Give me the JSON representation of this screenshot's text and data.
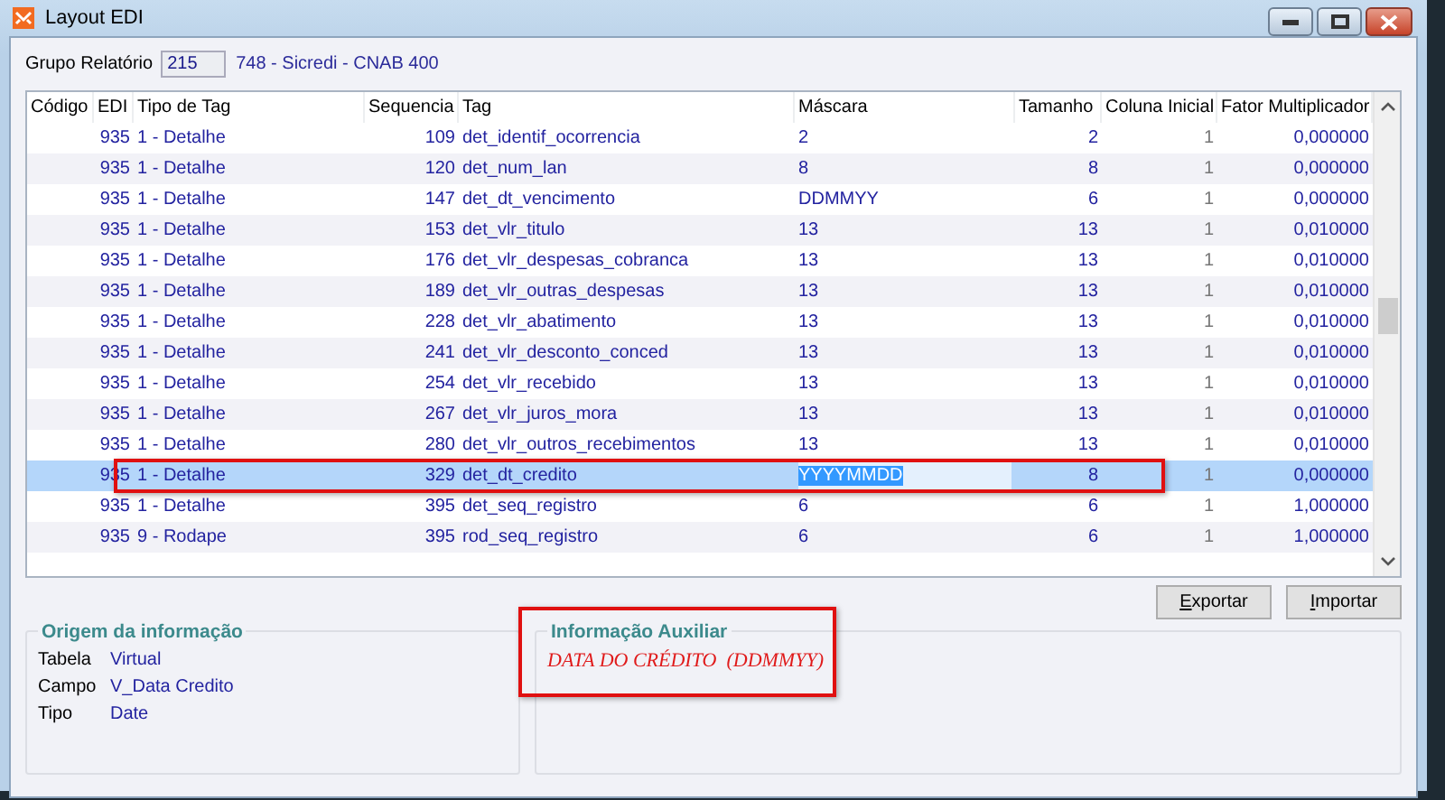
{
  "window": {
    "title": "Layout EDI"
  },
  "group": {
    "label": "Grupo Relatório",
    "value": "215",
    "description": "748 - Sicredi - CNAB 400"
  },
  "table": {
    "columns": [
      "Código",
      "EDI",
      "Tipo de Tag",
      "Sequencia",
      "Tag",
      "Máscara",
      "Tamanho",
      "Coluna Inicial",
      "Fator Multiplicador"
    ],
    "rows": [
      {
        "edi": "935",
        "tipo": "1 - Detalhe",
        "seq": "109",
        "tag": "det_identif_ocorrencia",
        "mascara": "2",
        "tamanho": "2",
        "coluna": "1",
        "fator": "0,000000",
        "selected": false,
        "editing": false
      },
      {
        "edi": "935",
        "tipo": "1 - Detalhe",
        "seq": "120",
        "tag": "det_num_lan",
        "mascara": "8",
        "tamanho": "8",
        "coluna": "1",
        "fator": "0,000000",
        "selected": false,
        "editing": false
      },
      {
        "edi": "935",
        "tipo": "1 - Detalhe",
        "seq": "147",
        "tag": "det_dt_vencimento",
        "mascara": "DDMMYY",
        "tamanho": "6",
        "coluna": "1",
        "fator": "0,000000",
        "selected": false,
        "editing": false
      },
      {
        "edi": "935",
        "tipo": "1 - Detalhe",
        "seq": "153",
        "tag": "det_vlr_titulo",
        "mascara": "13",
        "tamanho": "13",
        "coluna": "1",
        "fator": "0,010000",
        "selected": false,
        "editing": false
      },
      {
        "edi": "935",
        "tipo": "1 - Detalhe",
        "seq": "176",
        "tag": "det_vlr_despesas_cobranca",
        "mascara": "13",
        "tamanho": "13",
        "coluna": "1",
        "fator": "0,010000",
        "selected": false,
        "editing": false
      },
      {
        "edi": "935",
        "tipo": "1 - Detalhe",
        "seq": "189",
        "tag": "det_vlr_outras_despesas",
        "mascara": "13",
        "tamanho": "13",
        "coluna": "1",
        "fator": "0,010000",
        "selected": false,
        "editing": false
      },
      {
        "edi": "935",
        "tipo": "1 - Detalhe",
        "seq": "228",
        "tag": "det_vlr_abatimento",
        "mascara": "13",
        "tamanho": "13",
        "coluna": "1",
        "fator": "0,010000",
        "selected": false,
        "editing": false
      },
      {
        "edi": "935",
        "tipo": "1 - Detalhe",
        "seq": "241",
        "tag": "det_vlr_desconto_conced",
        "mascara": "13",
        "tamanho": "13",
        "coluna": "1",
        "fator": "0,010000",
        "selected": false,
        "editing": false
      },
      {
        "edi": "935",
        "tipo": "1 - Detalhe",
        "seq": "254",
        "tag": "det_vlr_recebido",
        "mascara": "13",
        "tamanho": "13",
        "coluna": "1",
        "fator": "0,010000",
        "selected": false,
        "editing": false
      },
      {
        "edi": "935",
        "tipo": "1 - Detalhe",
        "seq": "267",
        "tag": "det_vlr_juros_mora",
        "mascara": "13",
        "tamanho": "13",
        "coluna": "1",
        "fator": "0,010000",
        "selected": false,
        "editing": false
      },
      {
        "edi": "935",
        "tipo": "1 - Detalhe",
        "seq": "280",
        "tag": "det_vlr_outros_recebimentos",
        "mascara": "13",
        "tamanho": "13",
        "coluna": "1",
        "fator": "0,010000",
        "selected": false,
        "editing": false
      },
      {
        "edi": "935",
        "tipo": "1 - Detalhe",
        "seq": "329",
        "tag": "det_dt_credito",
        "mascara": "YYYYMMDD",
        "tamanho": "8",
        "coluna": "1",
        "fator": "0,000000",
        "selected": true,
        "editing": true
      },
      {
        "edi": "935",
        "tipo": "1 - Detalhe",
        "seq": "395",
        "tag": "det_seq_registro",
        "mascara": "6",
        "tamanho": "6",
        "coluna": "1",
        "fator": "1,000000",
        "selected": false,
        "editing": false
      },
      {
        "edi": "935",
        "tipo": "9 - Rodape",
        "seq": "395",
        "tag": "rod_seq_registro",
        "mascara": "6",
        "tamanho": "6",
        "coluna": "1",
        "fator": "1,000000",
        "selected": false,
        "editing": false
      }
    ]
  },
  "buttons": [
    "Exportar",
    "Importar"
  ],
  "origem": {
    "title": "Origem da informação",
    "fields": [
      {
        "label": "Tabela",
        "value": "Virtual"
      },
      {
        "label": "Campo",
        "value": "V_Data Credito"
      },
      {
        "label": "Tipo",
        "value": "Date"
      }
    ]
  },
  "auxiliar": {
    "title": "Informação Auxiliar",
    "text": "DATA DO CRÉDITO  (DDMMYY)"
  }
}
